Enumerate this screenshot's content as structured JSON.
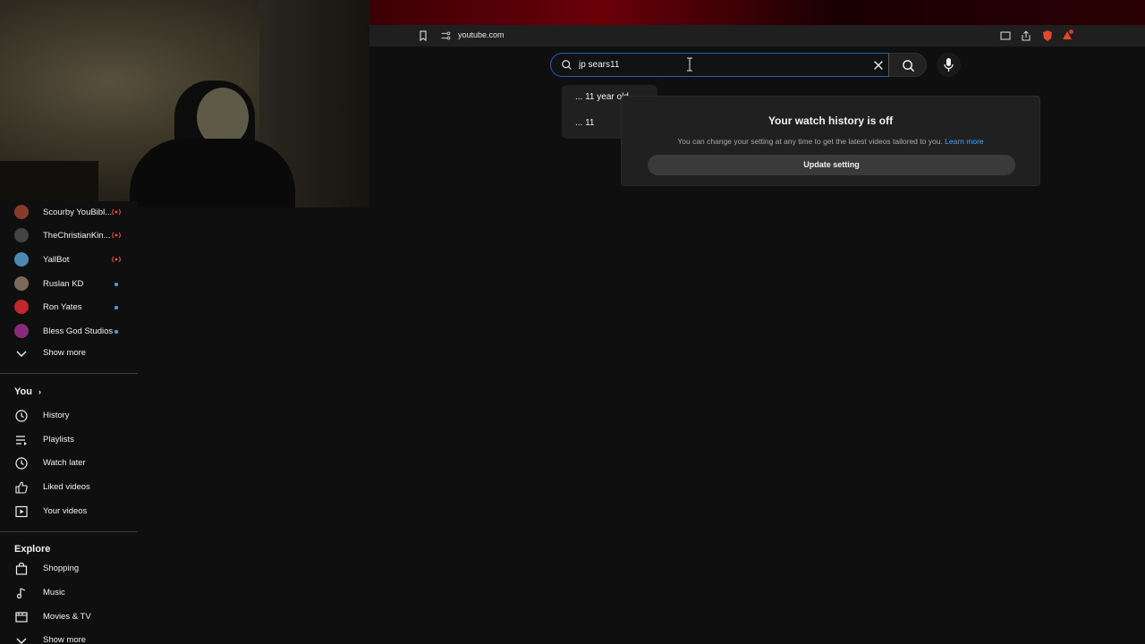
{
  "browser": {
    "url": "youtube.com"
  },
  "search": {
    "query": "jp sears11",
    "suggestions": [
      "... 11 year old",
      "... 11"
    ]
  },
  "history_card": {
    "title": "Your watch history is off",
    "description": "You can change your setting at any time to get the latest videos tailored to you.",
    "learn_more": "Learn more",
    "button": "Update setting"
  },
  "sidebar": {
    "subscriptions": [
      {
        "label": "Scourby YouBibl...",
        "status": "live",
        "avatar_color": "#8a3a2a"
      },
      {
        "label": "TheChristianKin...",
        "status": "live",
        "avatar_color": "#444444"
      },
      {
        "label": "YallBot",
        "status": "live",
        "avatar_color": "#4a8ab0"
      },
      {
        "label": "Ruslan KD",
        "status": "new",
        "avatar_color": "#7a6a5a"
      },
      {
        "label": "Ron Yates",
        "status": "new",
        "avatar_color": "#c0262b"
      },
      {
        "label": "Bless God Studios",
        "status": "new",
        "avatar_color": "#8a2a7a"
      }
    ],
    "show_more_1": "Show more",
    "you_section": "You",
    "you_items": [
      "History",
      "Playlists",
      "Watch later",
      "Liked videos",
      "Your videos"
    ],
    "explore_section": "Explore",
    "explore_items": [
      "Shopping",
      "Music",
      "Movies & TV"
    ],
    "show_more_2": "Show more"
  },
  "colors": {
    "background": "#0f0f0f",
    "accent_blue": "#3ea6ff",
    "live_red": "#ff4e45"
  }
}
